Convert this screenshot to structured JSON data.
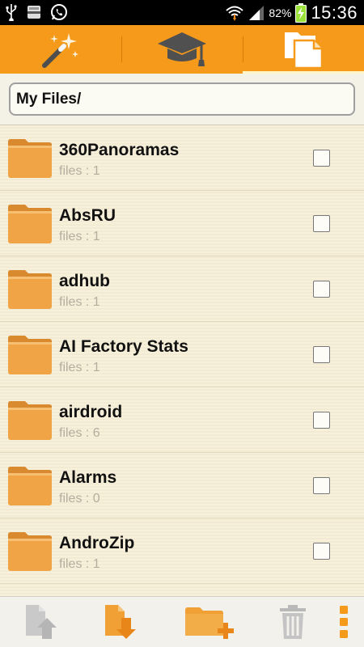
{
  "status_bar": {
    "battery_percent": "82%",
    "time": "15:36",
    "icons": [
      "usb-icon",
      "sd-card-icon",
      "whatsapp-icon",
      "wifi-icon",
      "signal-icon",
      "battery-charging-icon"
    ]
  },
  "tabs": [
    {
      "name": "tools",
      "icon": "magic-wand-icon",
      "active": false
    },
    {
      "name": "learn",
      "icon": "graduation-cap-icon",
      "active": false
    },
    {
      "name": "files",
      "icon": "files-icon",
      "active": true
    }
  ],
  "path_bar": {
    "value": "My Files/"
  },
  "files": [
    {
      "name": "360Panoramas",
      "count": "files : 1"
    },
    {
      "name": "AbsRU",
      "count": "files : 1"
    },
    {
      "name": "adhub",
      "count": "files : 1"
    },
    {
      "name": "AI Factory Stats",
      "count": "files : 1"
    },
    {
      "name": "airdroid",
      "count": "files : 6"
    },
    {
      "name": "Alarms",
      "count": "files : 0"
    },
    {
      "name": "AndroZip",
      "count": "files : 1"
    }
  ],
  "toolbar": {
    "actions": [
      {
        "icon": "upload-file-icon",
        "enabled": false
      },
      {
        "icon": "download-file-icon",
        "enabled": true
      },
      {
        "icon": "new-folder-icon",
        "enabled": true
      },
      {
        "icon": "trash-icon",
        "enabled": false
      },
      {
        "icon": "overflow-menu-icon",
        "enabled": true
      }
    ]
  },
  "colors": {
    "accent": "#f59a1b",
    "folder": "#f0a445",
    "list_background": "#f6eed6",
    "muted_text": "#b4ae9f"
  }
}
